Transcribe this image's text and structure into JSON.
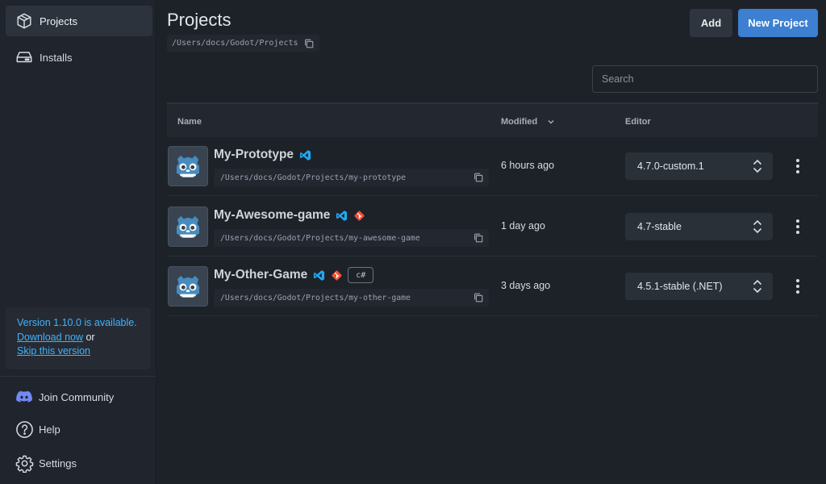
{
  "sidebar": {
    "nav": [
      {
        "label": "Projects",
        "icon": "box-icon",
        "active": true
      },
      {
        "label": "Installs",
        "icon": "drive-icon",
        "active": false
      }
    ],
    "update": {
      "version_text": "Version 1.10.0 is available.",
      "download_link": "Download now",
      "or_text": " or",
      "skip_link": "Skip this version"
    },
    "bottom": [
      {
        "label": "Join Community",
        "icon": "discord-icon"
      },
      {
        "label": "Help",
        "icon": "help-circle-icon"
      },
      {
        "label": "Settings",
        "icon": "gear-icon"
      }
    ]
  },
  "header": {
    "title": "Projects",
    "path": "/Users/docs/Godot/Projects",
    "add_label": "Add",
    "new_project_label": "New Project",
    "search_placeholder": "Search"
  },
  "table": {
    "columns": {
      "name": "Name",
      "modified": "Modified",
      "editor": "Editor"
    },
    "rows": [
      {
        "name": "My-Prototype",
        "path": "/Users/docs/Godot/Projects/my-prototype",
        "modified": "6 hours ago",
        "editor": "4.7.0-custom.1",
        "badges": [
          "vscode-icon"
        ]
      },
      {
        "name": "My-Awesome-game",
        "path": "/Users/docs/Godot/Projects/my-awesome-game",
        "modified": "1 day ago",
        "editor": "4.7-stable",
        "badges": [
          "vscode-icon",
          "git-icon"
        ]
      },
      {
        "name": "My-Other-Game",
        "path": "/Users/docs/Godot/Projects/my-other-game",
        "modified": "3 days ago",
        "editor": "4.5.1-stable (.NET)",
        "badges": [
          "vscode-icon",
          "git-icon"
        ],
        "tag": "c#"
      }
    ]
  },
  "colors": {
    "accent": "#3d7fd1",
    "link": "#3fb3ff",
    "background": "#1d2229",
    "sidebar": "#20252d",
    "godot_blue": "#478cbf",
    "vscode_blue": "#23a9f2",
    "git_orange": "#f05033"
  }
}
